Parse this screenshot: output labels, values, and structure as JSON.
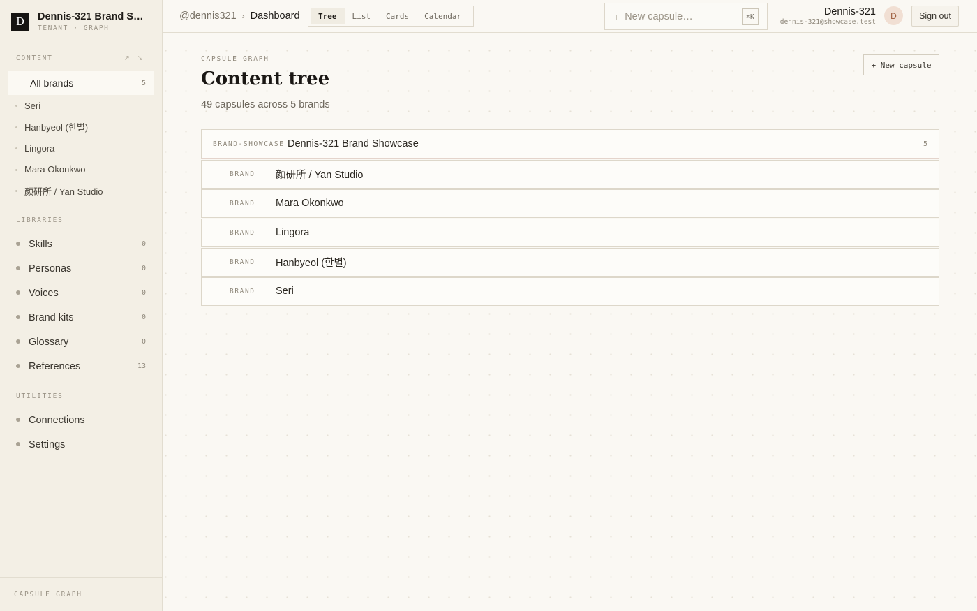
{
  "tenant": {
    "logo_letter": "D",
    "name": "Dennis-321 Brand Showcase",
    "subtitle": "TENANT · GRAPH"
  },
  "sidebar": {
    "content_label": "CONTENT",
    "content_tools": "↗ ↘",
    "all_brands": {
      "label": "All brands",
      "count": "5"
    },
    "brands": [
      {
        "label": "Seri"
      },
      {
        "label": "Hanbyeol (한별)"
      },
      {
        "label": "Lingora"
      },
      {
        "label": "Mara Okonkwo"
      },
      {
        "label": "颜研所 / Yan Studio"
      }
    ],
    "libraries_label": "LIBRARIES",
    "libraries": [
      {
        "label": "Skills",
        "count": "0"
      },
      {
        "label": "Personas",
        "count": "0"
      },
      {
        "label": "Voices",
        "count": "0"
      },
      {
        "label": "Brand kits",
        "count": "0"
      },
      {
        "label": "Glossary",
        "count": "0"
      },
      {
        "label": "References",
        "count": "13"
      }
    ],
    "utilities_label": "UTILITIES",
    "utilities": [
      {
        "label": "Connections"
      },
      {
        "label": "Settings"
      }
    ],
    "footer": "CAPSULE GRAPH"
  },
  "topbar": {
    "breadcrumb_user": "@dennis321",
    "breadcrumb_sep": "›",
    "breadcrumb_current": "Dashboard",
    "view_tabs": [
      {
        "label": "Tree",
        "active": true
      },
      {
        "label": "List"
      },
      {
        "label": "Cards"
      },
      {
        "label": "Calendar"
      }
    ],
    "new_capsule_placeholder": "New capsule…",
    "new_capsule_plus": "+",
    "shortcut": "⌘K",
    "user_name": "Dennis-321",
    "user_email": "dennis-321@showcase.test",
    "avatar_letter": "D",
    "sign_out": "Sign out"
  },
  "main": {
    "eyebrow": "CAPSULE GRAPH",
    "title": "Content tree",
    "subtitle": "49 capsules across 5 brands",
    "new_capsule_button": "+ New capsule",
    "tree": {
      "root": {
        "kind": "BRAND-SHOWCASE",
        "name": "Dennis-321 Brand Showcase",
        "count": "5"
      },
      "children": [
        {
          "kind": "BRAND",
          "name": "颜研所 / Yan Studio"
        },
        {
          "kind": "BRAND",
          "name": "Mara Okonkwo"
        },
        {
          "kind": "BRAND",
          "name": "Lingora"
        },
        {
          "kind": "BRAND",
          "name": "Hanbyeol (한별)"
        },
        {
          "kind": "BRAND",
          "name": "Seri"
        }
      ]
    }
  }
}
